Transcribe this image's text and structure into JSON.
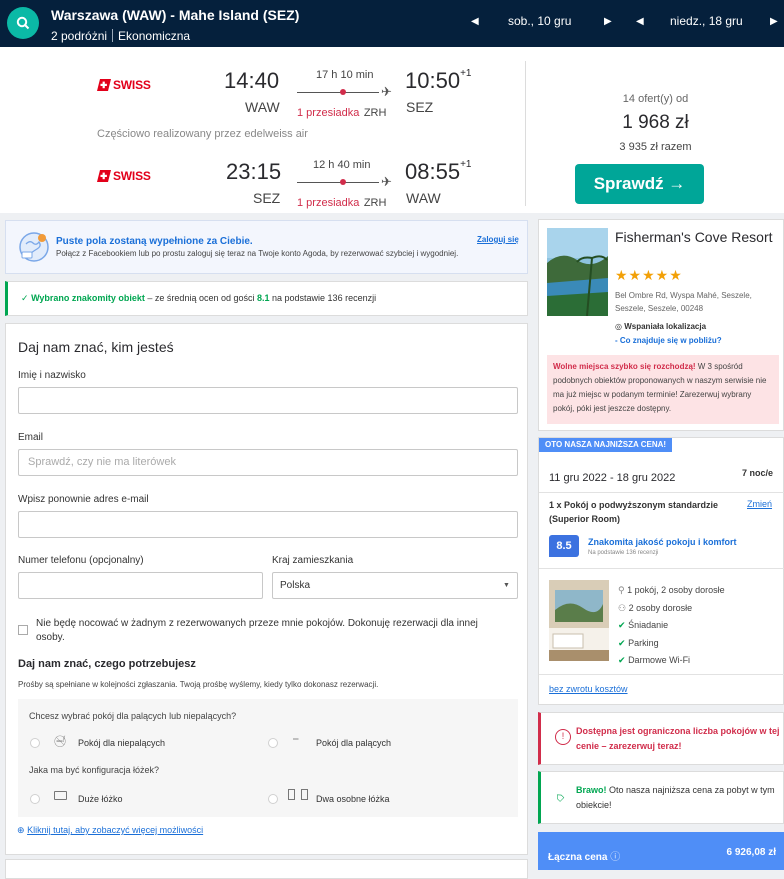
{
  "header": {
    "route": "Warszawa (WAW) - Mahe Island (SEZ)",
    "travellers": "2 podróżni",
    "cabin": "Ekonomiczna",
    "date_out": "sob., 10 gru",
    "date_back": "niedz., 18 gru"
  },
  "flight": {
    "outbound": {
      "airline": "SWISS",
      "dep_time": "14:40",
      "dep_apt": "WAW",
      "duration": "17 h 10 min",
      "stop": "1 przesiadka",
      "stop_apt": "ZRH",
      "arr_time": "10:50",
      "arr_plus": "+1",
      "arr_apt": "SEZ"
    },
    "operated_by": "Częściowo realizowany przez edelweiss air",
    "inbound": {
      "airline": "SWISS",
      "dep_time": "23:15",
      "dep_apt": "SEZ",
      "duration": "12 h 40 min",
      "stop": "1 przesiadka",
      "stop_apt": "ZRH",
      "arr_time": "08:55",
      "arr_plus": "+1",
      "arr_apt": "WAW"
    },
    "offers": "14 ofert(y) od",
    "price": "1 968 zł",
    "total": "3 935 zł razem",
    "check_label": "Sprawdź →"
  },
  "fb": {
    "title": "Puste pola zostaną wypełnione za Ciebie.",
    "body": "Połącz z Facebookiem lub po prostu zaloguj się teraz na Twoje konto Agoda, by rezerwować szybciej i wygodniej.",
    "login": "Zaloguj się"
  },
  "selected": {
    "strong": "Wybrano znakomity obiekt",
    "text1": " – ze średnią ocen od gości ",
    "score": "8.1",
    "text2": " na podstawie 136 recenzji"
  },
  "form": {
    "title": "Daj nam znać, kim jesteś",
    "name_label": "Imię i nazwisko",
    "email_label": "Email",
    "email_placeholder": "Sprawdź, czy nie ma literówek",
    "email2_label": "Wpisz ponownie adres e-mail",
    "phone_label": "Numer telefonu (opcjonalny)",
    "country_label": "Kraj zamieszkania",
    "country_value": "Polska",
    "not_staying": "Nie będę nocować w żadnym z rezerwowanych przeze mnie pokojów. Dokonuję rezerwacji dla innej osoby.",
    "needs_title": "Daj nam znać, czego potrzebujesz",
    "needs_note": "Prośby są spełniane w kolejności zgłaszania. Twoją prośbę wyślemy, kiedy tylko dokonasz rezerwacji.",
    "smoking_q": "Chcesz wybrać pokój dla palących lub niepalących?",
    "non_smoking": "Pokój dla niepalących",
    "smoking": "Pokój dla palących",
    "bed_q": "Jaka ma być konfiguracja łóżek?",
    "big_bed": "Duże łóżko",
    "twin_beds": "Dwa osobne łóżka",
    "more": "Kliknij tutaj, aby zobaczyć więcej możliwości"
  },
  "hotel": {
    "name": "Fisherman's Cove Resort",
    "stars": "★★★★★",
    "address": "Bel Ombre Rd, Wyspa Mahé, Seszele, Seszele, Seszele, 00248",
    "location": "Wspaniała lokalizacja",
    "nearby": "- Co znajduje się w pobliżu?",
    "alert_strong": "Wolne miejsca szybko się rozchodzą!",
    "alert_text": " W 3 spośród podobnych obiektów proponowanych w naszym serwisie nie ma już miejsc w podanym terminie! Zarezerwuj wybrany pokój, póki jest jeszcze dostępny."
  },
  "booking": {
    "badge": "OTO NASZA NAJNIŻSZA CENA!",
    "dates": "11 gru 2022 - 18 gru 2022",
    "nights": "7 noc/e",
    "room": "1 x Pokój o podwyższonym standardzie (Superior Room)",
    "change": "Zmień",
    "score": "8.5",
    "score_text": "Znakomita jakość pokoju i komfort",
    "score_sub": "Na podstawie 136 recenzji",
    "feat1": "1 pokój, 2 osoby dorosłe",
    "feat2": "2 osoby dorosłe",
    "feat3": "Śniadanie",
    "feat4": "Parking",
    "feat5": "Darmowe Wi-Fi",
    "no_refund": "bez zwrotu kosztów"
  },
  "limited": {
    "text": "Dostępna jest ograniczona liczba pokojów w tej cenie – zarezerwuj teraz!"
  },
  "bravo": {
    "strong": "Brawo!",
    "text": " Oto nasza najniższa cena za pobyt w tym obiekcie!"
  },
  "totalbar": {
    "label": "Łączna cena",
    "price": "6 926,08 zł"
  }
}
